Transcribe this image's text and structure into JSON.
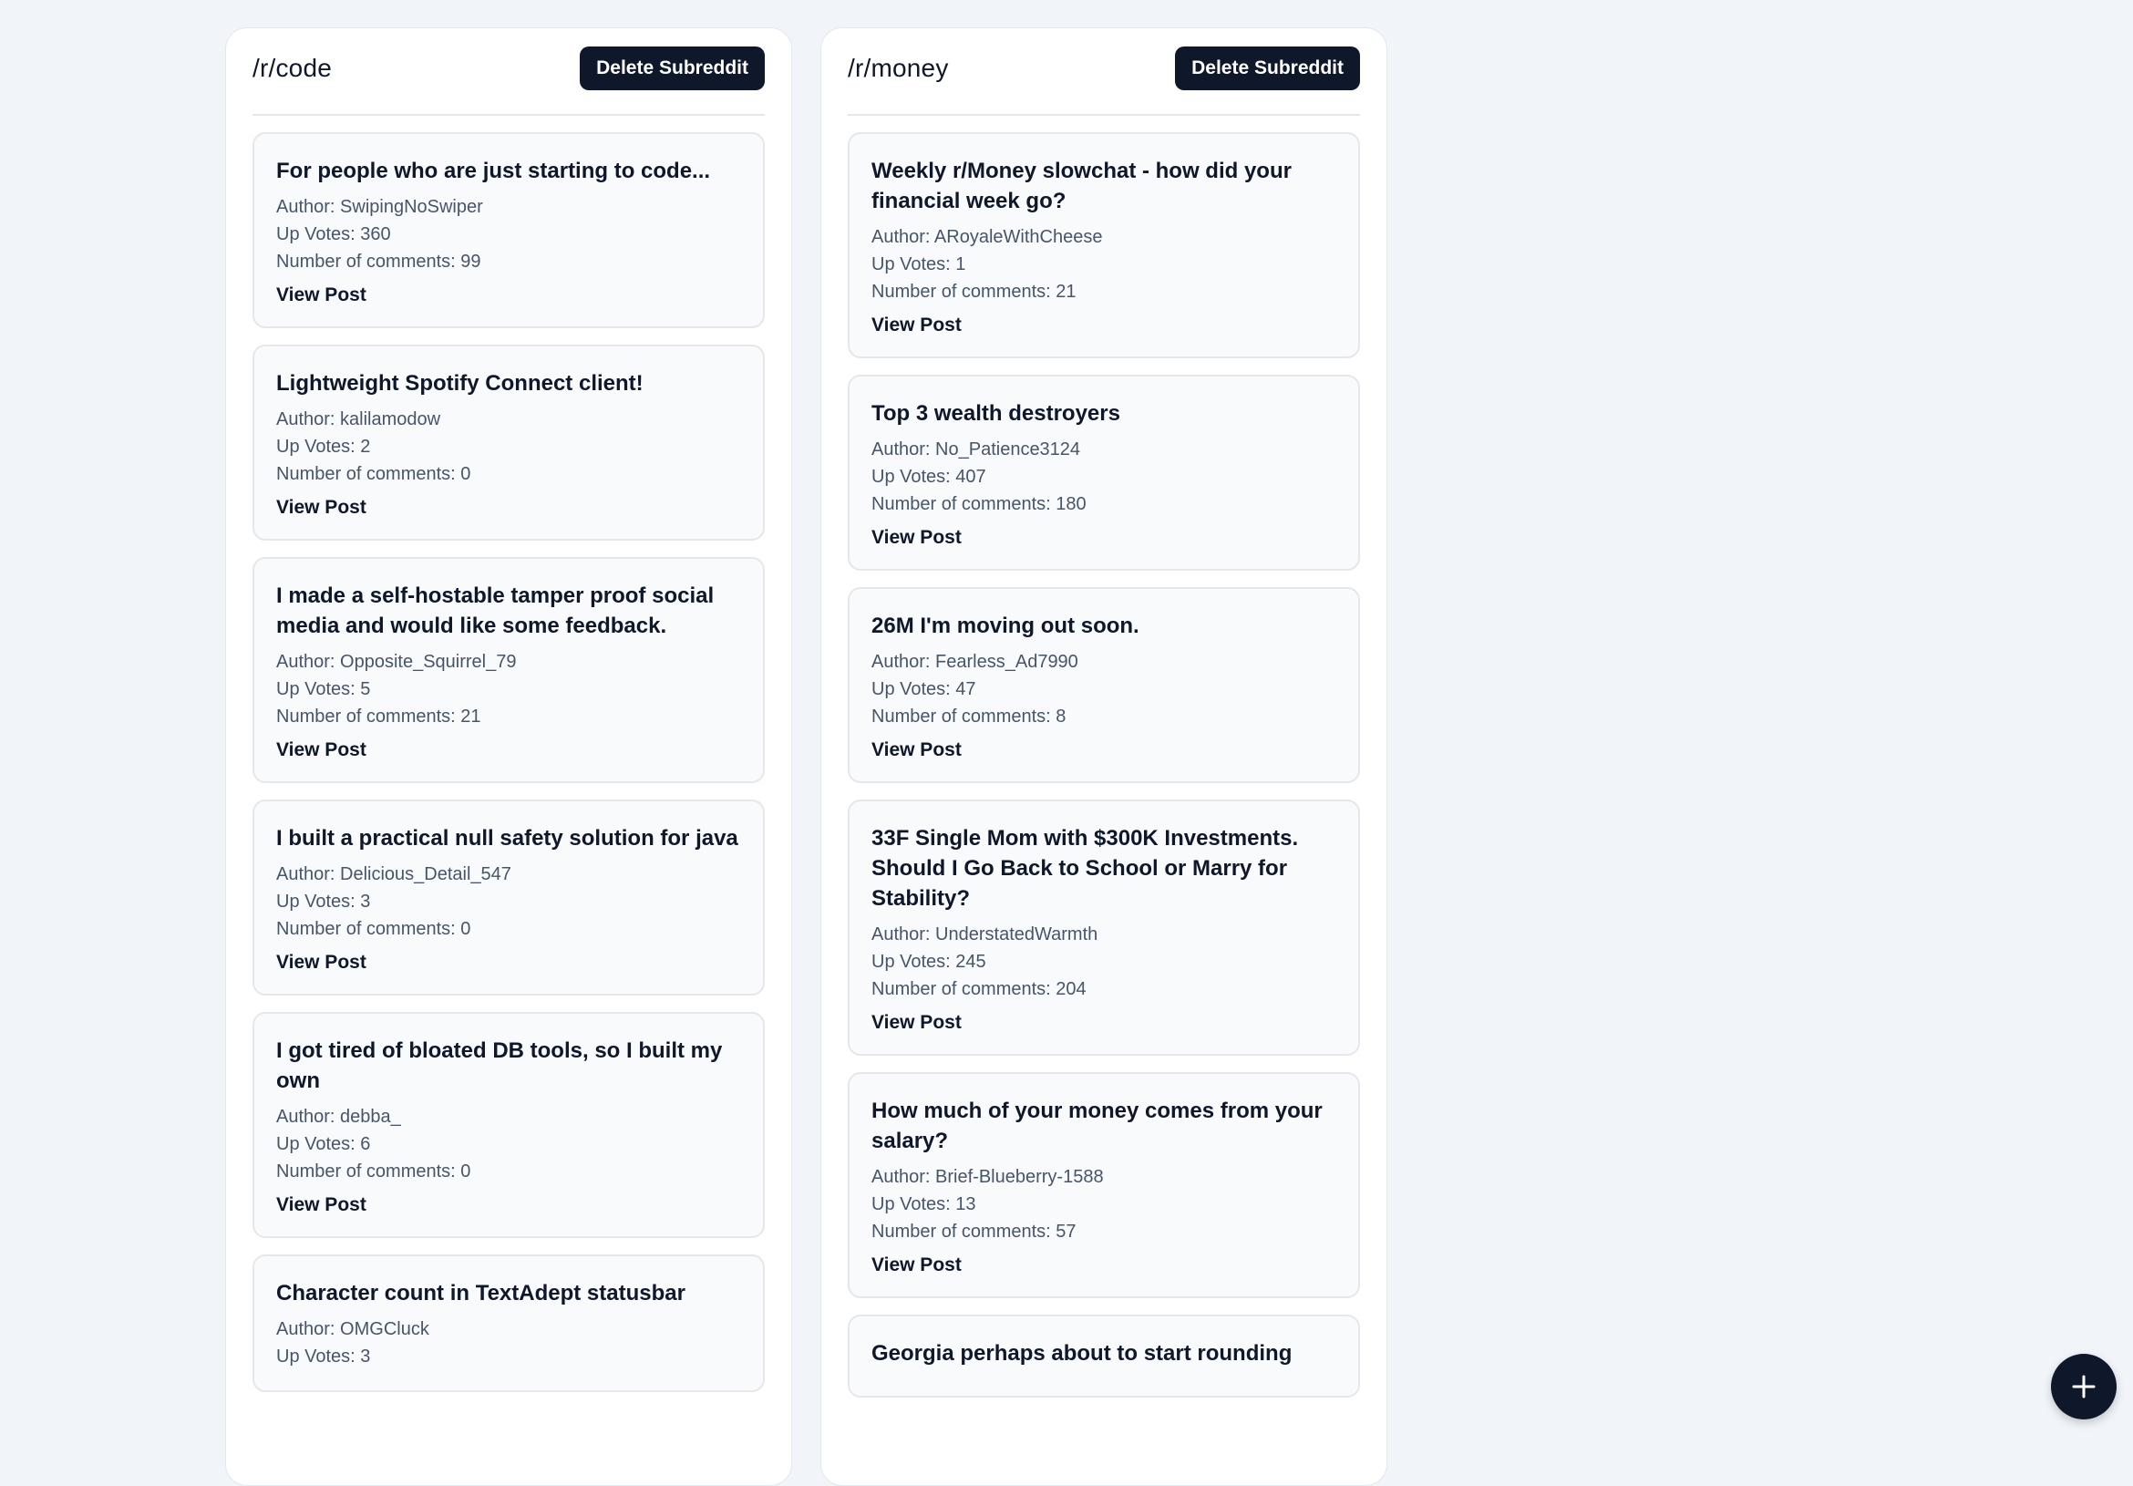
{
  "columns": [
    {
      "title": "/r/code",
      "delete_label": "Delete Subreddit",
      "posts": [
        {
          "title": "For people who are just starting to code...",
          "author": "Author: SwipingNoSwiper",
          "upvotes": "Up Votes: 360",
          "comments": "Number of comments: 99",
          "view_label": "View Post"
        },
        {
          "title": "Lightweight Spotify Connect client!",
          "author": "Author: kalilamodow",
          "upvotes": "Up Votes: 2",
          "comments": "Number of comments: 0",
          "view_label": "View Post"
        },
        {
          "title": "I made a self-hostable tamper proof social media and would like some feedback.",
          "author": "Author: Opposite_Squirrel_79",
          "upvotes": "Up Votes: 5",
          "comments": "Number of comments: 21",
          "view_label": "View Post"
        },
        {
          "title": "I built a practical null safety solution for java",
          "author": "Author: Delicious_Detail_547",
          "upvotes": "Up Votes: 3",
          "comments": "Number of comments: 0",
          "view_label": "View Post"
        },
        {
          "title": "I got tired of bloated DB tools, so I built my own",
          "author": "Author: debba_",
          "upvotes": "Up Votes: 6",
          "comments": "Number of comments: 0",
          "view_label": "View Post"
        },
        {
          "title": "Character count in TextAdept statusbar",
          "author": "Author: OMGCluck",
          "upvotes": "Up Votes: 3",
          "comments": "",
          "view_label": ""
        }
      ]
    },
    {
      "title": "/r/money",
      "delete_label": "Delete Subreddit",
      "posts": [
        {
          "title": "Weekly r/Money slowchat - how did your financial week go?",
          "author": "Author: ARoyaleWithCheese",
          "upvotes": "Up Votes: 1",
          "comments": "Number of comments: 21",
          "view_label": "View Post"
        },
        {
          "title": "Top 3 wealth destroyers",
          "author": "Author: No_Patience3124",
          "upvotes": "Up Votes: 407",
          "comments": "Number of comments: 180",
          "view_label": "View Post"
        },
        {
          "title": "26M I'm moving out soon.",
          "author": "Author: Fearless_Ad7990",
          "upvotes": "Up Votes: 47",
          "comments": "Number of comments: 8",
          "view_label": "View Post"
        },
        {
          "title": "33F Single Mom with $300K Investments. Should I Go Back to School or Marry for Stability?",
          "author": "Author: UnderstatedWarmth",
          "upvotes": "Up Votes: 245",
          "comments": "Number of comments: 204",
          "view_label": "View Post"
        },
        {
          "title": "How much of your money comes from your salary?",
          "author": "Author: Brief-Blueberry-1588",
          "upvotes": "Up Votes: 13",
          "comments": "Number of comments: 57",
          "view_label": "View Post"
        },
        {
          "title": "Georgia perhaps about to start rounding",
          "author": "",
          "upvotes": "",
          "comments": "",
          "view_label": ""
        }
      ]
    }
  ],
  "fab": {
    "icon": "plus-icon"
  }
}
